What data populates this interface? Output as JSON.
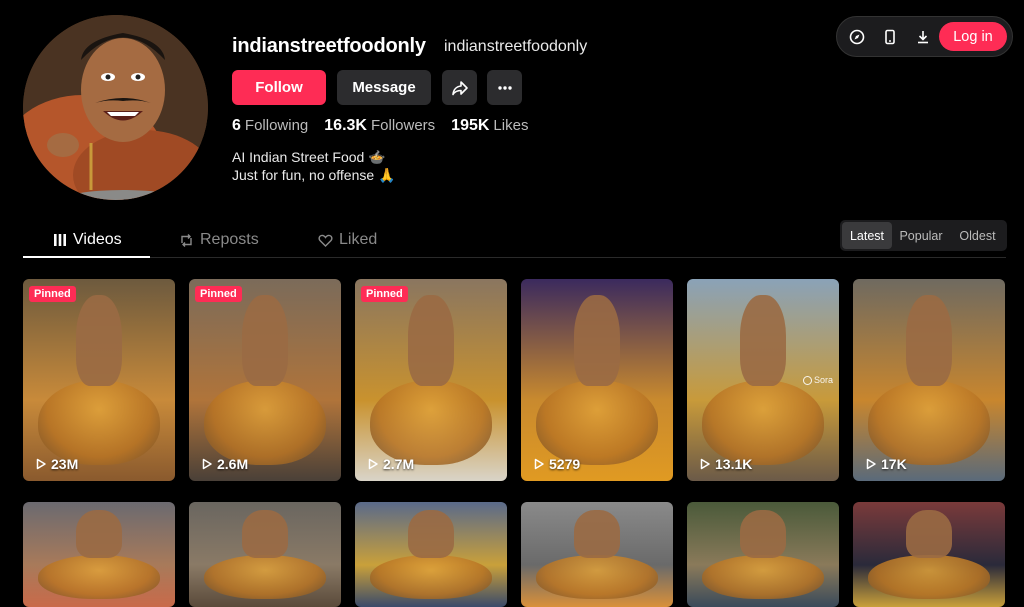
{
  "profile": {
    "username": "indianstreetfoodonly",
    "nickname": "indianstreetfoodonly",
    "follow_label": "Follow",
    "message_label": "Message",
    "stats": [
      {
        "value": "6",
        "label": "Following"
      },
      {
        "value": "16.3K",
        "label": "Followers"
      },
      {
        "value": "195K",
        "label": "Likes"
      }
    ],
    "bio_line1": "AI Indian Street Food 🍲",
    "bio_line2": "Just for fun, no offense 🙏"
  },
  "topbar": {
    "icons": [
      "compass-icon",
      "phone-icon",
      "download-icon"
    ],
    "login_label": "Log in"
  },
  "tabs": [
    {
      "label": "Videos",
      "icon": "grid-icon"
    },
    {
      "label": "Reposts",
      "icon": "repost-icon"
    },
    {
      "label": "Liked",
      "icon": "heart-icon"
    }
  ],
  "sort": [
    "Latest",
    "Popular",
    "Oldest"
  ],
  "colors": {
    "accent": "#fe2c55",
    "background": "#000000"
  },
  "videos": [
    {
      "pinned": true,
      "badge": "Pinned",
      "views": "23M"
    },
    {
      "pinned": true,
      "badge": "Pinned",
      "views": "2.6M"
    },
    {
      "pinned": true,
      "badge": "Pinned",
      "views": "2.7M"
    },
    {
      "pinned": false,
      "views": "5279"
    },
    {
      "pinned": false,
      "views": "13.1K",
      "watermark": "Sora"
    },
    {
      "pinned": false,
      "views": "17K"
    },
    {
      "pinned": false,
      "views": ""
    },
    {
      "pinned": false,
      "views": ""
    },
    {
      "pinned": false,
      "views": ""
    },
    {
      "pinned": false,
      "views": ""
    },
    {
      "pinned": false,
      "views": ""
    },
    {
      "pinned": false,
      "views": ""
    }
  ]
}
